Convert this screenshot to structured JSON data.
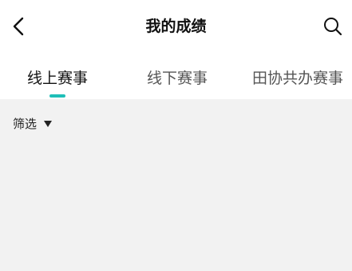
{
  "header": {
    "title": "我的成绩",
    "back_icon": "chevron-left-icon",
    "search_icon": "search-icon"
  },
  "tabs": [
    {
      "label": "线上赛事",
      "active": true
    },
    {
      "label": "线下赛事",
      "active": false
    },
    {
      "label": "田协共办赛事",
      "active": false
    }
  ],
  "filter": {
    "label": "筛选",
    "arrow_icon": "caret-down-icon"
  },
  "colors": {
    "accent": "#1fbfb8",
    "background": "#f2f2f2",
    "header_background": "#ffffff"
  }
}
